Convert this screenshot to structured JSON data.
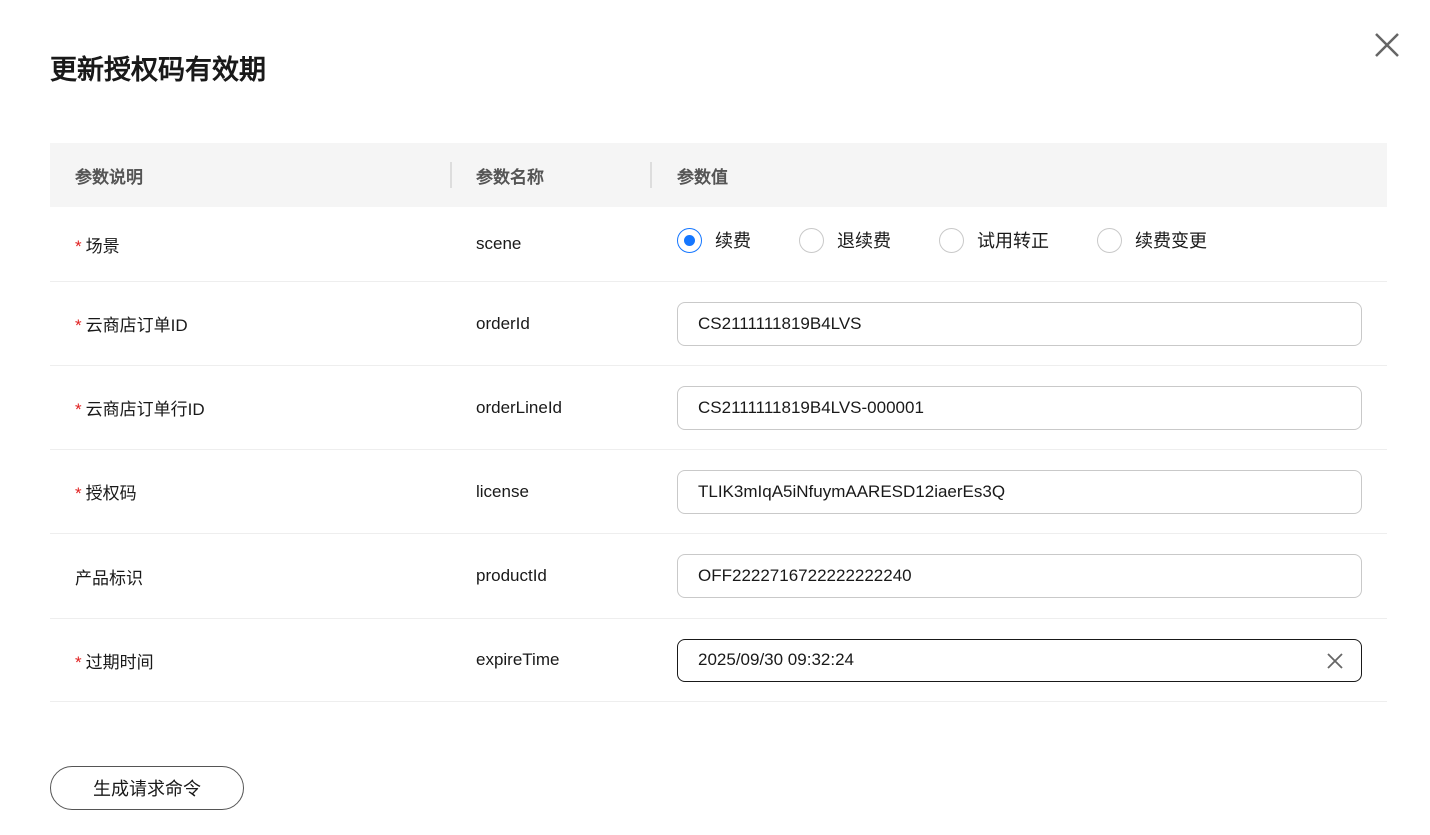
{
  "title": "更新授权码有效期",
  "table": {
    "headers": [
      "参数说明",
      "参数名称",
      "参数值"
    ],
    "rows": [
      {
        "label": "场景",
        "required": true,
        "name": "scene",
        "type": "radio",
        "options": [
          "续费",
          "退续费",
          "试用转正",
          "续费变更"
        ],
        "selected": "续费"
      },
      {
        "label": "云商店订单ID",
        "required": true,
        "name": "orderId",
        "value": "CS2111111819B4LVS"
      },
      {
        "label": "云商店订单行ID",
        "required": true,
        "name": "orderLineId",
        "value": "CS2111111819B4LVS-000001"
      },
      {
        "label": "授权码",
        "required": true,
        "name": "license",
        "value": "TLIK3mIqA5iNfuymAARESD12iaerEs3Q"
      },
      {
        "label": "产品标识",
        "required": false,
        "name": "productId",
        "value": "OFF2222716722222222240"
      },
      {
        "label": "过期时间",
        "required": true,
        "name": "expireTime",
        "value": "2025/09/30 09:32:24"
      }
    ]
  },
  "required_mark": "*",
  "generate_button": "生成请求命令",
  "colors": {
    "accent": "#1476ff",
    "required": "#e02020"
  }
}
